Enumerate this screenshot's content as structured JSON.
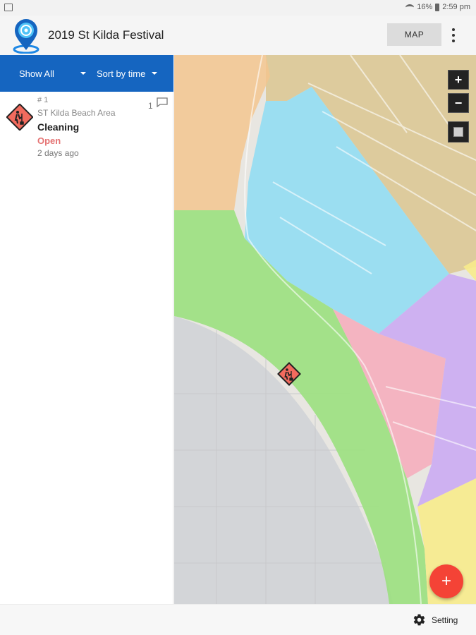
{
  "status_bar": {
    "battery": "16%",
    "time": "2:59 pm"
  },
  "app": {
    "title": "2019 St Kilda Festival",
    "map_button": "MAP",
    "menu_icon": "more-vert-icon"
  },
  "filters": {
    "show": "Show All",
    "sort": "Sort by time"
  },
  "reports": [
    {
      "number": "# 1",
      "location": "ST Kilda Beach Area",
      "category": "Cleaning",
      "status": "Open",
      "time": "2 days ago",
      "comments": "1",
      "icon": "cleaning-warning-icon"
    }
  ],
  "map": {
    "zoom_in": "+",
    "zoom_out": "−",
    "zones": {
      "green": "#9be07f",
      "blue": "#8ddcf3",
      "orange": "#f3c58f",
      "pink": "#f5aebe",
      "purple": "#c9a7f3",
      "yellow": "#f7eb8c",
      "tan": "#dcc896",
      "water": "#d3d5d8"
    },
    "marker_color": "#f26b5e"
  },
  "fab": {
    "label": "+"
  },
  "bottom": {
    "setting": "Setting"
  }
}
